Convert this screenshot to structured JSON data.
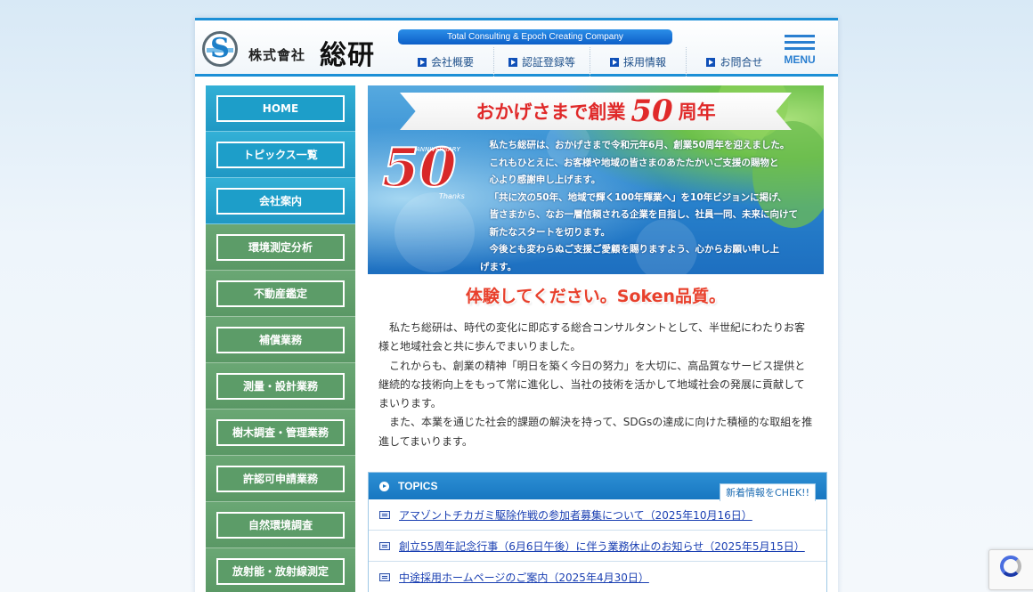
{
  "header": {
    "company_prefix": "株式會社",
    "company_name": "総研",
    "tagline": "Total Consulting & Epoch Creating Company",
    "nav": [
      {
        "label": "会社概要"
      },
      {
        "label": "認証登録等"
      },
      {
        "label": "採用情報"
      },
      {
        "label": "お問合せ"
      }
    ],
    "menu_label": "MENU"
  },
  "sidebar": {
    "items": [
      {
        "label": "HOME",
        "style": "blue"
      },
      {
        "label": "トピックス一覧",
        "style": "blue"
      },
      {
        "label": "会社案内",
        "style": "blue"
      },
      {
        "label": "環境測定分析",
        "style": "green"
      },
      {
        "label": "不動産鑑定",
        "style": "green"
      },
      {
        "label": "補償業務",
        "style": "green"
      },
      {
        "label": "測量・設計業務",
        "style": "green"
      },
      {
        "label": "樹木調査・管理業務",
        "style": "green"
      },
      {
        "label": "許認可申請業務",
        "style": "green"
      },
      {
        "label": "自然環境調査",
        "style": "green"
      },
      {
        "label": "放射能・放射線測定",
        "style": "green"
      }
    ]
  },
  "banner": {
    "ribbon_text_before": "おかげさまで創業",
    "ribbon_number": "50",
    "ribbon_text_after": "周年",
    "badge_number": "50",
    "badge_word_top": "ANNIVERSARY",
    "badge_word_bottom": "Thanks",
    "lines": [
      "私たち総研は、おかげさまで令和元年6月、創業50周年を迎えました。",
      "これもひとえに、お客様や地域の皆さまのあたたかいご支援の賜物と",
      "心より感謝申し上げます。",
      "「共に次の50年、地域で輝く100年輝業へ」を10年ビジョンに掲げ、",
      "皆さまから、なお一層信頼される企業を目指し、社員一同、未来に向けて",
      "新たなスタートを切ります。",
      "今後とも変わらぬご支援ご愛顧を賜りますよう、心からお願い申し上",
      "げます。"
    ]
  },
  "quality_heading": "体験してください。Soken品質。",
  "intro": {
    "paragraphs": [
      "私たち総研は、時代の変化に即応する総合コンサルタントとして、半世紀にわたりお客様と地域社会と共に歩んでまいりました。",
      "これからも、創業の精神「明日を築く今日の努力」を大切に、高品質なサービス提供と継続的な技術向上をもって常に進化し、当社の技術を活かして地域社会の発展に貢献してまいります。",
      "また、本業を通じた社会的課題の解決を持って、SDGsの達成に向けた積極的な取組を推進してまいります。"
    ]
  },
  "topics": {
    "title": "TOPICS",
    "check_label": "新着情報をCHEK!!",
    "items": [
      {
        "text": "アマゾントチカガミ駆除作戦の参加者募集について（2025年10月16日）"
      },
      {
        "text": "創立55周年記念行事（6月6日午後）に伴う業務休止のお知らせ（2025年5月15日）"
      },
      {
        "text": "中途採用ホームページのご案内（2025年4月30日）"
      }
    ]
  },
  "colors": {
    "accent_blue": "#1c8fd6",
    "sidebar_blue": "#1d9ec9",
    "sidebar_green": "#5c9c68",
    "heading_red": "#e8402c",
    "link_blue": "#1a3fb2"
  }
}
